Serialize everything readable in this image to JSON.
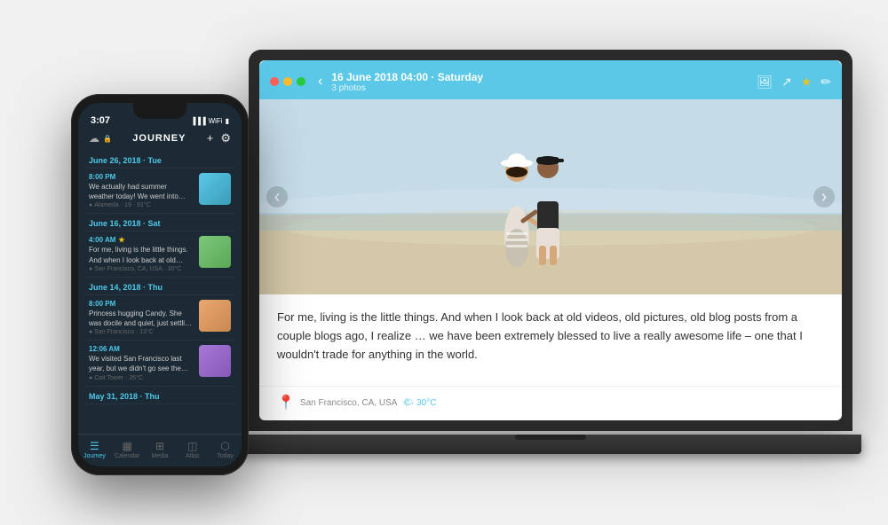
{
  "scene": {
    "bg_color": "#f0f0f0"
  },
  "laptop": {
    "titlebar": {
      "date": "16 June 2018 04:00 · Saturday",
      "photos_count": "3 photos",
      "back_icon": "‹",
      "dots": [
        "red",
        "yellow",
        "green"
      ]
    },
    "entry": {
      "text": "For me, living is the little things. And when I look back at old videos, old pictures, old blog posts from a couple blogs ago, I realize … we have been extremely blessed to live a really awesome life – one that I wouldn't trade for anything in the world.",
      "location": "San Francisco, CA, USA",
      "weather": "30°C",
      "nav_left": "‹",
      "nav_right": "›"
    }
  },
  "phone": {
    "status": {
      "time": "3:07",
      "icons": [
        "signal",
        "wifi",
        "battery"
      ]
    },
    "navbar": {
      "app_name": "JOURNEY",
      "add_label": "+",
      "settings_label": "⚙"
    },
    "entries": [
      {
        "date_header": "June 26, 2018 · Tue",
        "time": "8:00 PM",
        "text": "We actually had summer weather today! We went into town for a stroll, and I pic…",
        "location": "Alameda · 19 · 91°C",
        "has_star": false,
        "thumb_color": "blue"
      },
      {
        "date_header": "June 16, 2018 · Sat",
        "time": "4:00 AM",
        "text": "For me, living is the little things. And when I look back at old videos, old pictures, old…",
        "location": "San Francisco, CA, USA · 30°C",
        "has_star": true,
        "thumb_color": "green"
      },
      {
        "date_header": "June 14, 2018 · Thu",
        "time": "8:00 PM",
        "text": "Princess hugging Candy. She was docile and quiet, just settling into her arms wi…",
        "location": "San Francisco · 13°C",
        "has_star": false,
        "thumb_color": "orange"
      },
      {
        "date_header": "",
        "time": "12:06 AM",
        "text": "We visited San Francisco last year, but we didn't go see the Golden Gate Brid…",
        "location": "Coit Tower · 26°C",
        "has_star": false,
        "thumb_color": "purple"
      },
      {
        "date_header": "May 31, 2018 · Thu",
        "time": "",
        "text": "",
        "location": "",
        "has_star": false,
        "thumb_color": ""
      }
    ],
    "tabs": [
      {
        "label": "Journey",
        "icon": "☰",
        "active": true
      },
      {
        "label": "Calendar",
        "icon": "▦",
        "active": false
      },
      {
        "label": "Media",
        "icon": "⊞",
        "active": false
      },
      {
        "label": "Atlas",
        "icon": "◫",
        "active": false
      },
      {
        "label": "Today",
        "icon": "⬡",
        "active": false
      }
    ]
  },
  "app_branding": {
    "title": "JouRNey"
  }
}
